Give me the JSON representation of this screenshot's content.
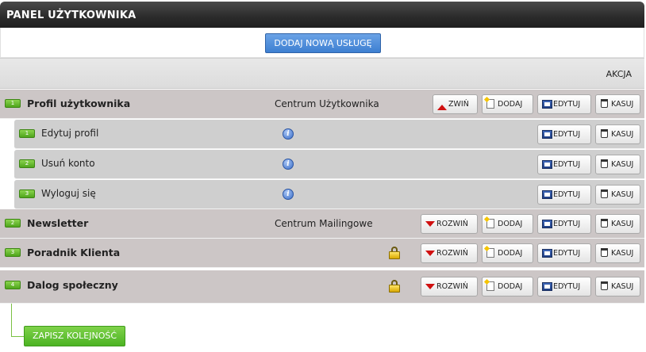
{
  "header": {
    "title": "PANEL UŻYTKOWNIKA"
  },
  "add_service_label": "DODAJ NOWĄ USŁUGĘ",
  "table_header": {
    "action": "AKCJA"
  },
  "buttons": {
    "collapse": "ZWIŃ",
    "expand": "ROZWIŃ",
    "add": "DODAJ",
    "edit": "EDYTUJ",
    "delete": "KASUJ"
  },
  "rows": [
    {
      "num": "1",
      "title": "Profil użytkownika",
      "center": "Centrum Użytkownika",
      "expanded": true
    },
    {
      "num": "1",
      "title": "Edytuj profil",
      "sub": true
    },
    {
      "num": "2",
      "title": "Usuń konto",
      "sub": true
    },
    {
      "num": "3",
      "title": "Wyloguj się",
      "sub": true
    },
    {
      "num": "2",
      "title": "Newsletter",
      "center": "Centrum Mailingowe"
    },
    {
      "num": "3",
      "title": "Poradnik Klienta",
      "locked": true
    },
    {
      "num": "4",
      "title": "Dalog społeczny",
      "locked": true
    }
  ],
  "save_order_label": "ZAPISZ KOLEJNOŚĆ",
  "colors": {
    "header": "#2b2b2b",
    "accent_blue": "#3d7fd1",
    "accent_green": "#4cb323",
    "row_bg": "#ccc6c6"
  }
}
